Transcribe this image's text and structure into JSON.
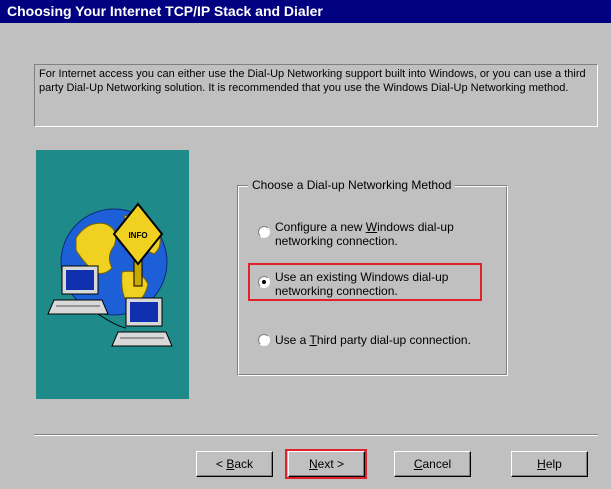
{
  "window": {
    "title": "Choosing Your Internet TCP/IP Stack and Dialer"
  },
  "intro_text": "For Internet access you can either use the Dial-Up Networking support built into Windows, or you can use a third party Dial-Up Networking solution.  It is recommended that you use the Windows Dial-Up Networking method.",
  "illustration": {
    "sign_text": "INFO"
  },
  "group": {
    "title": "Choose a Dial-up Networking Method",
    "options": [
      {
        "pre": "Configure a new ",
        "key": "W",
        "post": "indows dial-up networking connection.",
        "selected": false
      },
      {
        "pre": "Use an existing Windows dial-up networking connection.",
        "key": "",
        "post": "",
        "selected": true
      },
      {
        "pre": "Use a ",
        "key": "T",
        "post": "hird party dial-up connection.",
        "selected": false
      }
    ]
  },
  "buttons": {
    "back": {
      "pre": "< ",
      "key": "B",
      "post": "ack"
    },
    "next": {
      "pre": "",
      "key": "N",
      "post": "ext >"
    },
    "cancel": {
      "pre": "",
      "key": "C",
      "post": "ancel"
    },
    "help": {
      "pre": "",
      "key": "H",
      "post": "elp"
    }
  },
  "colors": {
    "titlebar": "#000080",
    "highlight": "#e0202a",
    "art_bg": "#1f8a8a"
  }
}
